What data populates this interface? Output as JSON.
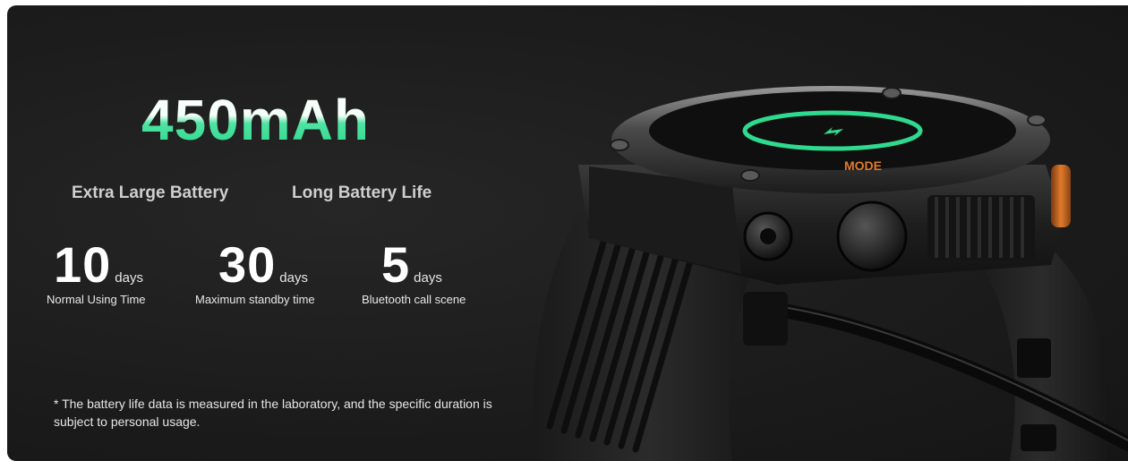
{
  "headline": "450mAh",
  "features": [
    {
      "label": "Extra Large Battery"
    },
    {
      "label": "Long Battery Life"
    }
  ],
  "stats": [
    {
      "number": "10",
      "unit": "days",
      "description": "Normal Using Time"
    },
    {
      "number": "30",
      "unit": "days",
      "description": "Maximum standby time"
    },
    {
      "number": "5",
      "unit": "days",
      "description": "Bluetooth call scene"
    }
  ],
  "footnote": "* The battery life data is measured in the laboratory, and the specific duration is subject to personal usage.",
  "watch": {
    "bezel_label": "MODE"
  },
  "colors": {
    "accent_green": "#2fd98d",
    "accent_orange": "#e07a2c",
    "background": "#1c1c1c"
  }
}
